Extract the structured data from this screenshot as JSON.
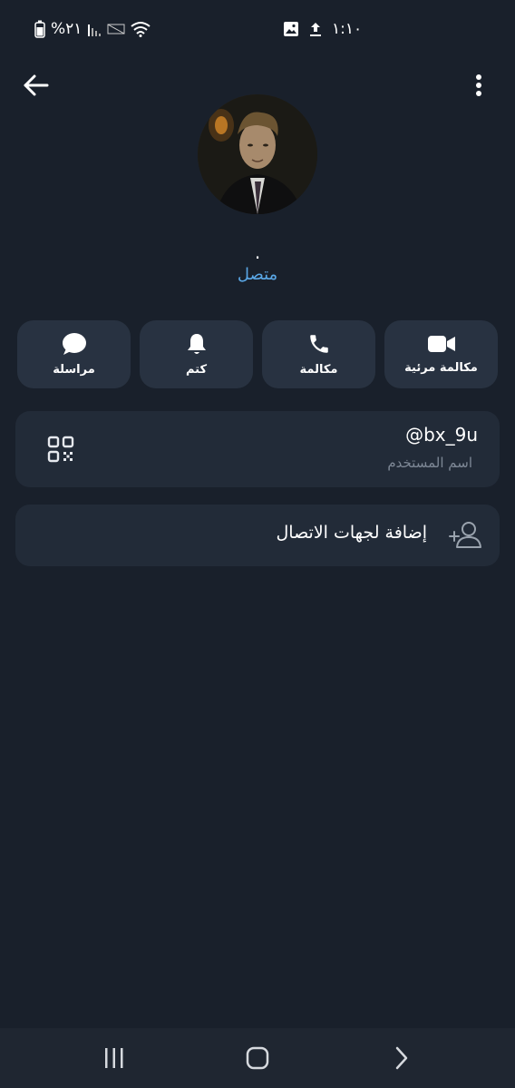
{
  "status_bar": {
    "battery": "%٢١",
    "time": "١:١٠"
  },
  "profile": {
    "name": ".",
    "status": "متصل",
    "status_color": "#5aa7e6"
  },
  "actions": [
    {
      "label": "مكالمة مرئية",
      "icon": "video-icon"
    },
    {
      "label": "مكالمة",
      "icon": "phone-icon"
    },
    {
      "label": "كتم",
      "icon": "bell-icon"
    },
    {
      "label": "مراسلة",
      "icon": "chat-icon"
    }
  ],
  "username_card": {
    "username": "@bx_9u",
    "caption": "اسم المستخدم",
    "icon": "qr-code-icon"
  },
  "add_contact": {
    "label": "إضافة لجهات الاتصال",
    "icon": "add-user-icon"
  },
  "nav_bar": {
    "recents_icon": "recents-icon",
    "home_icon": "home-icon",
    "back_icon": "chevron-right-icon"
  }
}
